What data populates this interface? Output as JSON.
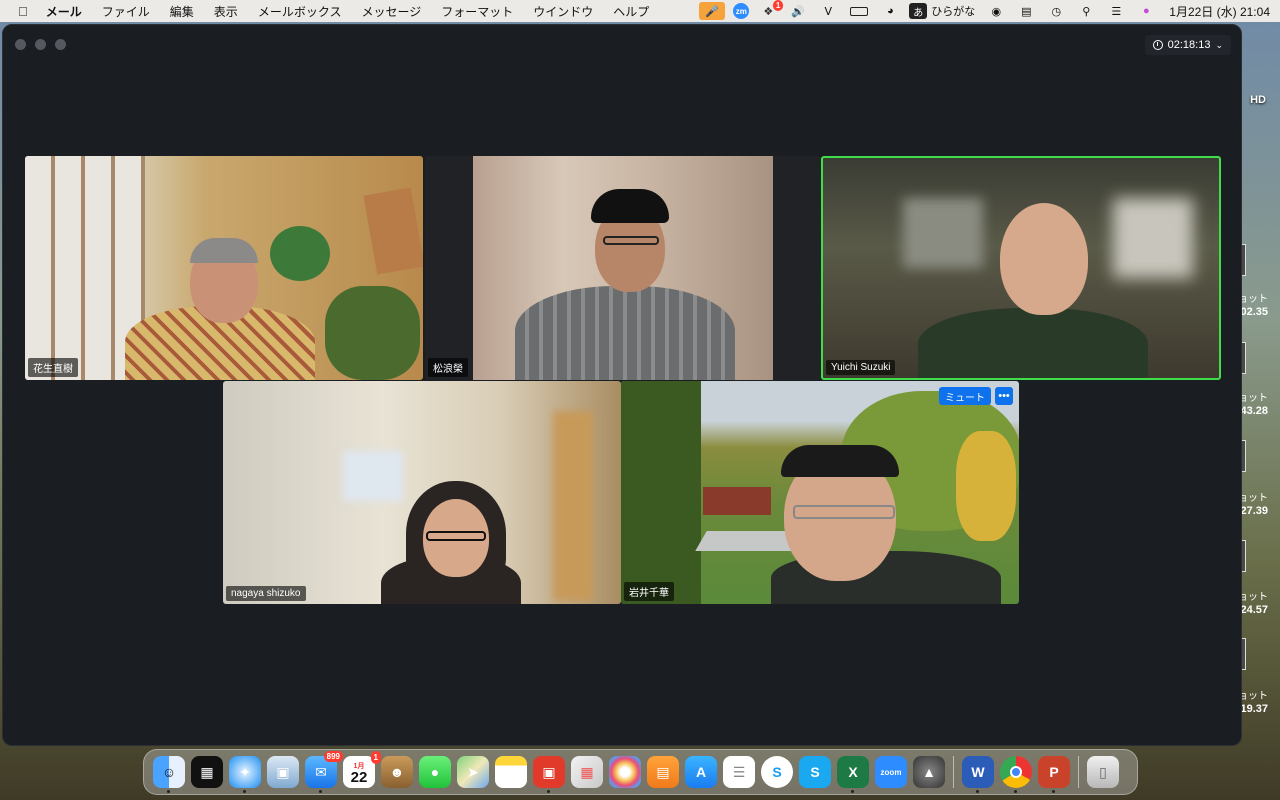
{
  "menubar": {
    "app_name": "メール",
    "items": [
      "ファイル",
      "編集",
      "表示",
      "メールボックス",
      "メッセージ",
      "フォーマット",
      "ウインドウ",
      "ヘルプ"
    ],
    "dropbox_badge": "1",
    "ime_glyph": "あ",
    "ime_label": "ひらがな",
    "clock": "1月22日 (水)  21:04"
  },
  "zoom": {
    "timer": "02:18:13",
    "participants": [
      {
        "name": "花生直樹"
      },
      {
        "name": "松浪榮"
      },
      {
        "name": "Yuichi Suzuki",
        "active": true
      },
      {
        "name": "nagaya shizuko"
      },
      {
        "name": "岩井千華",
        "mute_label": "ミュート",
        "more_label": "•••"
      }
    ]
  },
  "desktop": {
    "drive_label": "HD",
    "items": [
      {
        "prefix": "ョット",
        "value": "02.35"
      },
      {
        "prefix": "ョット",
        "value": "43.28"
      },
      {
        "prefix": "ョット",
        "value": "27.39"
      },
      {
        "prefix": "ョット",
        "value": "24.57"
      },
      {
        "prefix": "ョット",
        "value": "19.37"
      }
    ]
  },
  "dock": {
    "mail_badge": "899",
    "calendar_month": "1月",
    "calendar_day": "22",
    "calendar_badge": "1",
    "zoom_label": "zoom"
  },
  "colors": {
    "active_border": "#3fdd4a",
    "zoom_blue": "#0e72ed"
  }
}
